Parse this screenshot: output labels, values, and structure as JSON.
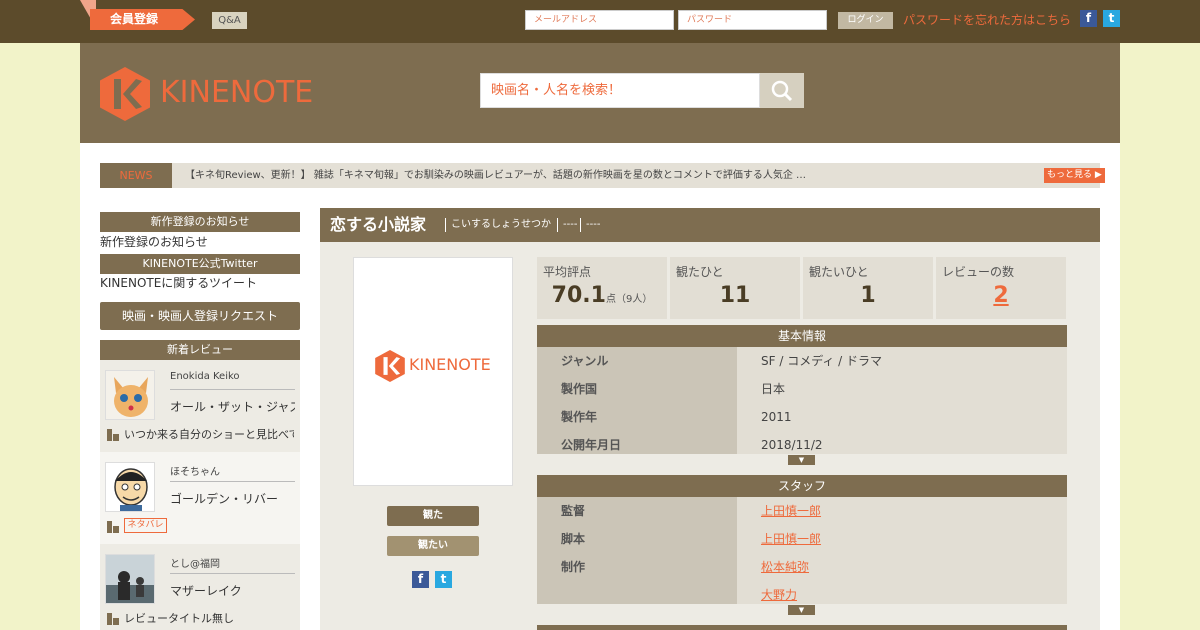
{
  "topbar": {
    "register_label": "会員登録",
    "qa_label": "Q&A",
    "email_placeholder": "メールアドレス",
    "password_placeholder": "パスワード",
    "login_label": "ログイン",
    "forgot_label": "パスワードを忘れた方はこちら",
    "facebook_glyph": "f",
    "twitter_glyph": "t"
  },
  "header": {
    "logo_text": "KINENOTE",
    "search_placeholder": "映画名・人名を検索！"
  },
  "news": {
    "label": "NEWS",
    "text": "【キネ旬Review、更新！】 雑誌「キネマ旬報」でお馴染みの映画レビュアーが、話題の新作映画を星の数とコメントで評価する人気企 …",
    "more_label": "もっと見る ▶"
  },
  "sidebar": {
    "new_arrivals_head": "新作登録のお知らせ",
    "new_arrivals_link": "新作登録のお知らせ",
    "twitter_head": "KINENOTE公式Twitter",
    "twitter_link": "KINENOTEに関するツイート",
    "request_label": "映画・映画人登録リクエスト",
    "reviews_head": "新着レビュー",
    "reviews": [
      {
        "user": "Enokida Keiko",
        "film": "オール・ザット・ジャズ",
        "title": "いつか来る自分のショーと見比べて"
      },
      {
        "user": "ほそちゃん",
        "film": "ゴールデン・リバー",
        "spoiler": "ネタバレ"
      },
      {
        "user": "とし@福岡",
        "film": "マザーレイク",
        "title": "レビュータイトル無し"
      }
    ]
  },
  "movie": {
    "title": "恋する小説家",
    "reading": "こいするしょうせつか",
    "dash1": "----",
    "dash2": "----",
    "poster_logo_text": "KINENOTE",
    "seen_label": "観た",
    "want_label": "観たい",
    "stats": {
      "avg_label": "平均評点",
      "avg_value": "70.1",
      "avg_unit": "点（9人）",
      "seen_label": "観たひと",
      "seen_value": "11",
      "want_label": "観たいひと",
      "want_value": "1",
      "reviews_label": "レビューの数",
      "reviews_value": "2"
    },
    "basic_info_head": "基本情報",
    "basic_info": [
      {
        "key": "ジャンル",
        "value": "SF / コメディ / ドラマ"
      },
      {
        "key": "製作国",
        "value": "日本"
      },
      {
        "key": "製作年",
        "value": "2011"
      },
      {
        "key": "公開年月日",
        "value": "2018/11/2"
      }
    ],
    "staff_head": "スタッフ",
    "staff": [
      {
        "key": "監督",
        "value": "上田慎一郎"
      },
      {
        "key": "脚本",
        "value": "上田慎一郎"
      },
      {
        "key": "制作",
        "value": "松本純弥"
      },
      {
        "key": "",
        "value": "大野力"
      }
    ],
    "expand_glyph": "▼"
  },
  "colors": {
    "accent": "#ee6a3c",
    "brown": "#7e6d50",
    "dark_brown": "#5c4b2b",
    "page_bg": "#f2f3c9"
  }
}
